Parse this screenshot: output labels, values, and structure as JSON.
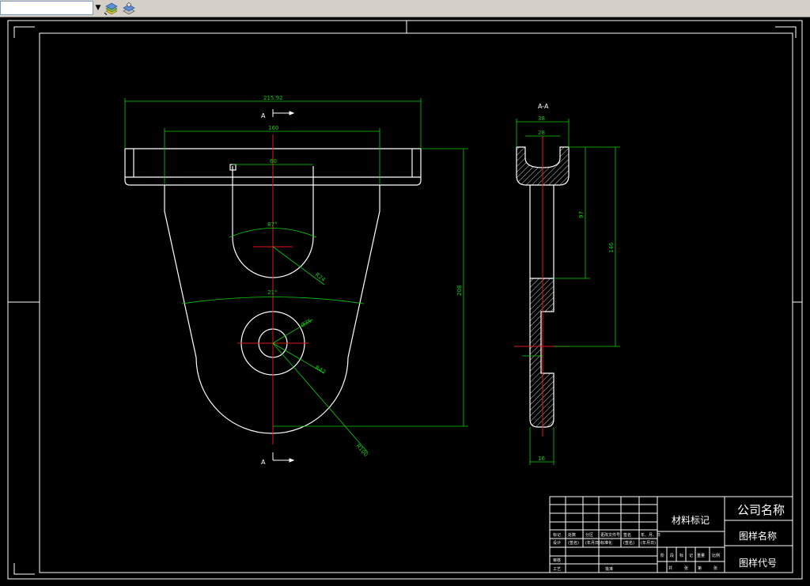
{
  "toolbar": {
    "layer_combo_value": "",
    "icons": [
      "layer-manager-icon",
      "layer-state-icon"
    ]
  },
  "drawing": {
    "front_view": {
      "dim_overall_width": "215.92",
      "dim_inner_width": "160",
      "dim_slot_width": "60",
      "dim_total_height": "208",
      "dim_arc_upper": "87°",
      "dim_arc_lower": "21°",
      "dim_slot_radius": "R24",
      "dim_hole_inner": "Ø35",
      "dim_hole_outer": "R42",
      "dim_bottom_radius": "R100",
      "section_label_top": "A",
      "section_label_bottom": "A"
    },
    "side_view": {
      "section_title": "A-A",
      "dim_top_outer": "38",
      "dim_top_inner": "28",
      "dim_height_upper": "97",
      "dim_height_total": "146",
      "dim_bottom_thickness": "16"
    }
  },
  "title_block": {
    "company_name": "公司名称",
    "material_mark": "材料标记",
    "drawing_name": "图样名称",
    "drawing_code": "图样代号",
    "row_labels": [
      "标记",
      "处数",
      "分区",
      "更改文件号",
      "签名",
      "年、月、日"
    ],
    "row_labels2": [
      "设计",
      "(签名)",
      "(年月日)",
      "标准化",
      "(签名)",
      "(年月日)"
    ],
    "stage_labels": [
      "阶",
      "段",
      "标",
      "记",
      "重量",
      "比例"
    ],
    "sheet_labels": [
      "共",
      "张",
      "第",
      "张"
    ],
    "review_label": "审核",
    "process_label": "工艺",
    "approve_label": "批准"
  }
}
